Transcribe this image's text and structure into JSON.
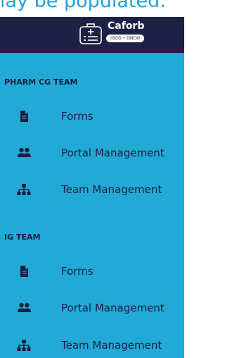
{
  "top_cut_text": "lay be populated.",
  "header": {
    "logo_name": "Caforb",
    "logo_tag": "IGOD • DHCW",
    "logo_icon": "clipboard-list-icon"
  },
  "sections": [
    {
      "title": "PHARM CG TEAM",
      "items": [
        {
          "label": "Forms",
          "icon": "document-icon"
        },
        {
          "label": "Portal Management",
          "icon": "users-icon"
        },
        {
          "label": "Team Management",
          "icon": "sitemap-icon"
        }
      ]
    },
    {
      "title": "IG TEAM",
      "items": [
        {
          "label": "Forms",
          "icon": "document-icon"
        },
        {
          "label": "Portal Management",
          "icon": "users-icon"
        },
        {
          "label": "Team Management",
          "icon": "sitemap-icon"
        }
      ]
    }
  ],
  "colors": {
    "sidebar_bg": "#23a9d6",
    "header_bg": "#1c2145",
    "text_dark": "#182040",
    "top_text": "#1fa3d8"
  }
}
